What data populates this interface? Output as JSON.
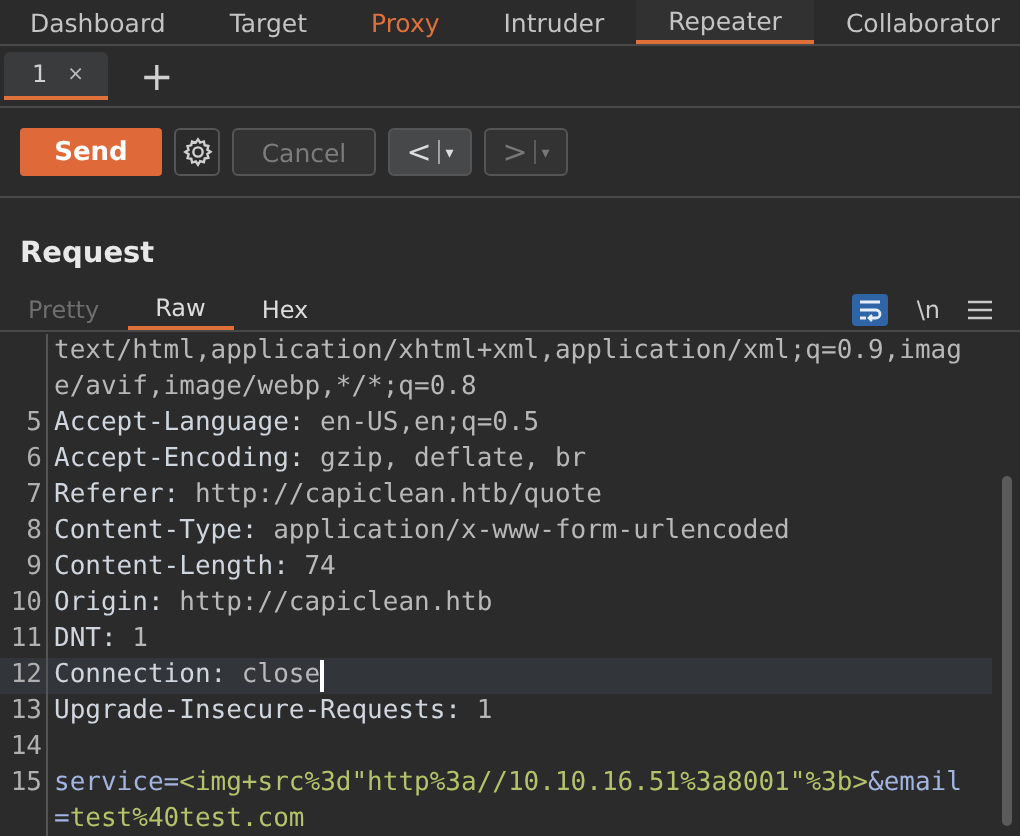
{
  "top_tabs": [
    {
      "label": "Dashboard",
      "selected": false,
      "highlighted": false
    },
    {
      "label": "Target",
      "selected": false,
      "highlighted": false
    },
    {
      "label": "Proxy",
      "selected": false,
      "highlighted": true
    },
    {
      "label": "Intruder",
      "selected": false,
      "highlighted": false
    },
    {
      "label": "Repeater",
      "selected": true,
      "highlighted": false
    },
    {
      "label": "Collaborator",
      "selected": false,
      "highlighted": false
    }
  ],
  "repeater_tabs": [
    {
      "label": "1",
      "close": "×",
      "selected": true
    }
  ],
  "add_tab": "+",
  "toolbar": {
    "send": "Send",
    "cancel": {
      "label": "Cancel",
      "disabled": true
    },
    "back": {
      "glyph": "<",
      "dropdown": "▾",
      "disabled": false
    },
    "forward": {
      "glyph": ">",
      "dropdown": "▾",
      "disabled": true
    }
  },
  "request": {
    "title": "Request",
    "view_tabs": [
      {
        "label": "Pretty",
        "selected": false,
        "disabled": true
      },
      {
        "label": "Raw",
        "selected": true,
        "disabled": false
      },
      {
        "label": "Hex",
        "selected": false,
        "disabled": false
      }
    ],
    "wrap_on": true,
    "newline_toggle": "\\n",
    "lines": [
      {
        "current": false,
        "segments": [
          {
            "kind": "value",
            "text": "text/html,application/xhtml+xml,application/xml;q=0.9,imag"
          }
        ]
      },
      {
        "current": false,
        "segments": [
          {
            "kind": "value",
            "text": "e/avif,image/webp,*/*;q=0.8"
          }
        ]
      },
      {
        "number": "5",
        "current": false,
        "segments": [
          {
            "kind": "name",
            "text": "Accept-Language:"
          },
          {
            "kind": "value",
            "text": " en-US,en;q=0.5"
          }
        ]
      },
      {
        "number": "6",
        "current": false,
        "segments": [
          {
            "kind": "name",
            "text": "Accept-Encoding:"
          },
          {
            "kind": "value",
            "text": " gzip, deflate, br"
          }
        ]
      },
      {
        "number": "7",
        "current": false,
        "segments": [
          {
            "kind": "name",
            "text": "Referer:"
          },
          {
            "kind": "value",
            "text": " http://capiclean.htb/quote"
          }
        ]
      },
      {
        "number": "8",
        "current": false,
        "segments": [
          {
            "kind": "name",
            "text": "Content-Type:"
          },
          {
            "kind": "value",
            "text": " application/x-www-form-urlencoded"
          }
        ]
      },
      {
        "number": "9",
        "current": false,
        "segments": [
          {
            "kind": "name",
            "text": "Content-Length:"
          },
          {
            "kind": "value",
            "text": " 74"
          }
        ]
      },
      {
        "number": "10",
        "current": false,
        "segments": [
          {
            "kind": "name",
            "text": "Origin:"
          },
          {
            "kind": "value",
            "text": " http://capiclean.htb"
          }
        ]
      },
      {
        "number": "11",
        "current": false,
        "segments": [
          {
            "kind": "name",
            "text": "DNT:"
          },
          {
            "kind": "value",
            "text": " 1"
          }
        ]
      },
      {
        "number": "12",
        "current": true,
        "segments": [
          {
            "kind": "name",
            "text": "Connection:"
          },
          {
            "kind": "value",
            "text": " close"
          }
        ]
      },
      {
        "number": "13",
        "current": false,
        "segments": [
          {
            "kind": "name",
            "text": "Upgrade-Insecure-Requests:"
          },
          {
            "kind": "value",
            "text": " 1"
          }
        ]
      },
      {
        "number": "14",
        "current": false
      },
      {
        "number": "15",
        "current": false,
        "segments": [
          {
            "kind": "param",
            "text": "service="
          },
          {
            "kind": "param_value",
            "text": "<img+src%3d\"http%3a//10.10.16.51%3a8001\"%3b>"
          },
          {
            "kind": "param",
            "text": "&email"
          }
        ]
      },
      {
        "current": false,
        "segments": [
          {
            "kind": "param",
            "text": "="
          },
          {
            "kind": "param_value",
            "text": "test%40test.com"
          }
        ]
      }
    ]
  }
}
